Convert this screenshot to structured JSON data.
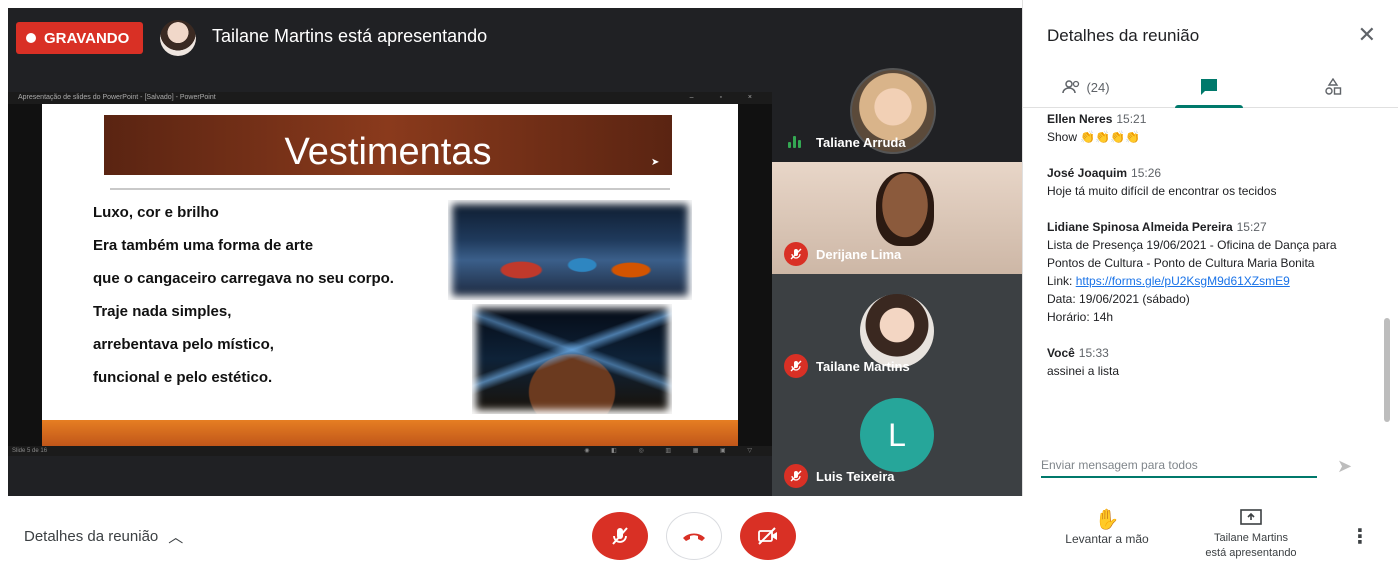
{
  "recording": {
    "label": "GRAVANDO"
  },
  "presenter": {
    "banner": "Tailane Martins está apresentando"
  },
  "presentation": {
    "window_title": "Apresentação de slides do PowerPoint - [Salvado] - PowerPoint",
    "slide_title": "Vestimentas",
    "lines": [
      "Luxo, cor e brilho",
      "Era também uma forma de arte",
      "que o cangaceiro carregava no seu corpo.",
      "Traje nada simples,",
      "arrebentava pelo místico,",
      "funcional e pelo estético."
    ],
    "status": "Slide 5 de 16"
  },
  "participants": [
    {
      "name": "Taliane Arruda",
      "mic": "speaking"
    },
    {
      "name": "Derijane Lima",
      "mic": "muted"
    },
    {
      "name": "Tailane Martins",
      "mic": "muted"
    },
    {
      "name": "Luis Teixeira",
      "mic": "muted",
      "initial": "L",
      "color": "#26a69a"
    }
  ],
  "panel": {
    "title": "Detalhes da reunião",
    "people_count": "(24)",
    "chat": [
      {
        "author": "Ellen Neres",
        "time": "15:21",
        "text": "Show 👏👏👏👏"
      },
      {
        "author": "José Joaquim",
        "time": "15:26",
        "text": "Hoje tá muito difícil de encontrar os tecidos"
      },
      {
        "author": "Lidiane Spinosa Almeida Pereira",
        "time": "15:27",
        "lines": [
          "Lista de Presença 19/06/2021 - Oficina de Dança para Pontos de Cultura -  Ponto de Cultura Maria Bonita"
        ],
        "link_label": "Link:",
        "link": "https://forms.gle/pU2KsgM9d61XZsmE9",
        "date": "Data: 19/06/2021 (sábado)",
        "hour": "Horário: 14h"
      },
      {
        "author": "Você",
        "time": "15:33",
        "text": "assinei a lista"
      }
    ],
    "compose_placeholder": "Enviar mensagem para todos"
  },
  "bottom": {
    "details_label": "Detalhes da reunião",
    "raise_hand": "Levantar a mão",
    "presenting_line1": "Tailane Martins",
    "presenting_line2": "está apresentando"
  },
  "colors": {
    "red": "#d93025",
    "teal": "#00796b",
    "dark": "#202124"
  }
}
